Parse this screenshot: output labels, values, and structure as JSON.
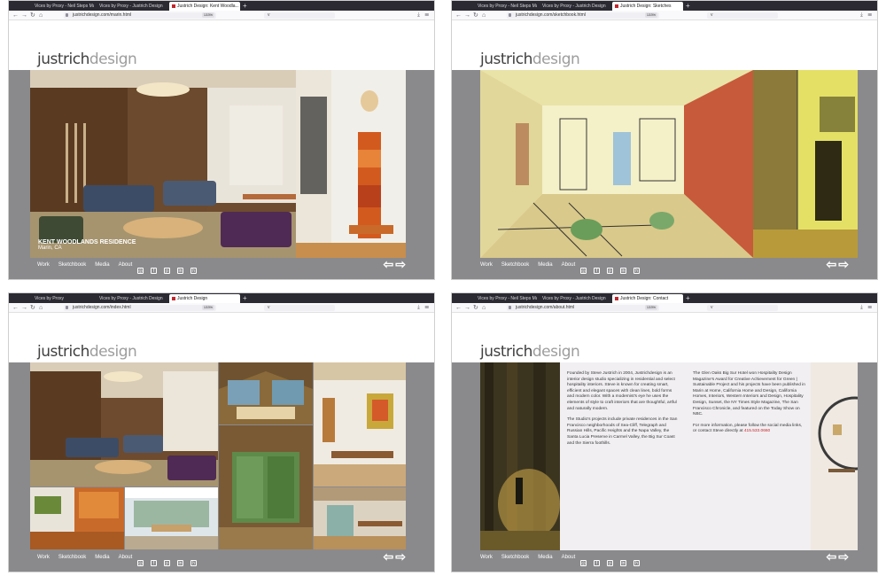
{
  "screens": [
    {
      "tabs": [
        "Vices by Proxy - Neil Steps Marti...",
        "Vices by Proxy - Justrich Design",
        "Justrich Design: Kent Woodla..."
      ],
      "url": "justrichdesign.com/marin.html",
      "zoom": "133%",
      "search": "v",
      "caption_title": "KENT WOODLANDS RESIDENCE",
      "caption_sub": "Marin, CA"
    },
    {
      "tabs": [
        "Vices by Proxy - Neil Steps Marti...",
        "Vices by Proxy - Justrich Design",
        "Justrich Design: Sketches"
      ],
      "url": "justrichdesign.com/sketchbook.html",
      "zoom": "133%",
      "search": "v"
    },
    {
      "tabs": [
        "Vices by Proxy",
        "Vices by Proxy - Justrich Design",
        "Justrich Design"
      ],
      "url": "justrichdesign.com/index.html",
      "zoom": "133%",
      "search": "v"
    },
    {
      "tabs": [
        "Vices by Proxy - Neil Steps Marti...",
        "Vices by Proxy - Justrich Design",
        "Justrich Design: Contact"
      ],
      "url": "justrichdesign.com/about.html",
      "zoom": "133%",
      "search": "v",
      "about_col1_p1": "Founded by Steve Justrich in 2004, Justrichdesign is an interior design studio specializing in residential and select hospitality interiors. Steve is known for creating smart, efficient and elegant spaces with clean lines, bold forms and modern color. With a modernist's eye he uses the elements of style to craft interiors that are thoughtful, artful and naturally modern.",
      "about_col1_p2": "The Studio's projects include private residences in the San Francisco neighborhoods of Sea-Cliff, Telegraph and Russian Hills, Pacific Heights and the Napa Valley, the Santa Lucia Preserve in Carmel Valley, the Big Sur Coast and the Sierra foothills.",
      "about_col2_p1": "The Glen Oaks Big Sur Hotel won Hospitality Design Magazine's Award for Creative Achievement for Green | Sustainable Project and his projects have been published in Marin at Home, California Home and Design, California Homes, Interiors, Western Interiors and Design, Hospitality Design, Sunset, the NY Times Style Magazine, The San Francisco Chronicle, and featured on the Today Show on NBC.",
      "about_col2_p2": "For more information, please follow the social media links, or contact Steve directly at",
      "phone": "415.533.0660"
    }
  ],
  "site": {
    "logo_bold": "justrich",
    "logo_light": "design",
    "nav": [
      "Work",
      "Sketchbook",
      "Media",
      "About"
    ],
    "social_icons": [
      "instagram-icon",
      "facebook-icon",
      "pinterest-icon",
      "linkedin-icon",
      "houzz-icon"
    ],
    "prev": "⇦",
    "next": "⇨"
  },
  "colors": {
    "band": "#8a8a8d",
    "accent": "#c2272d",
    "tabbar": "#2b2a33"
  }
}
